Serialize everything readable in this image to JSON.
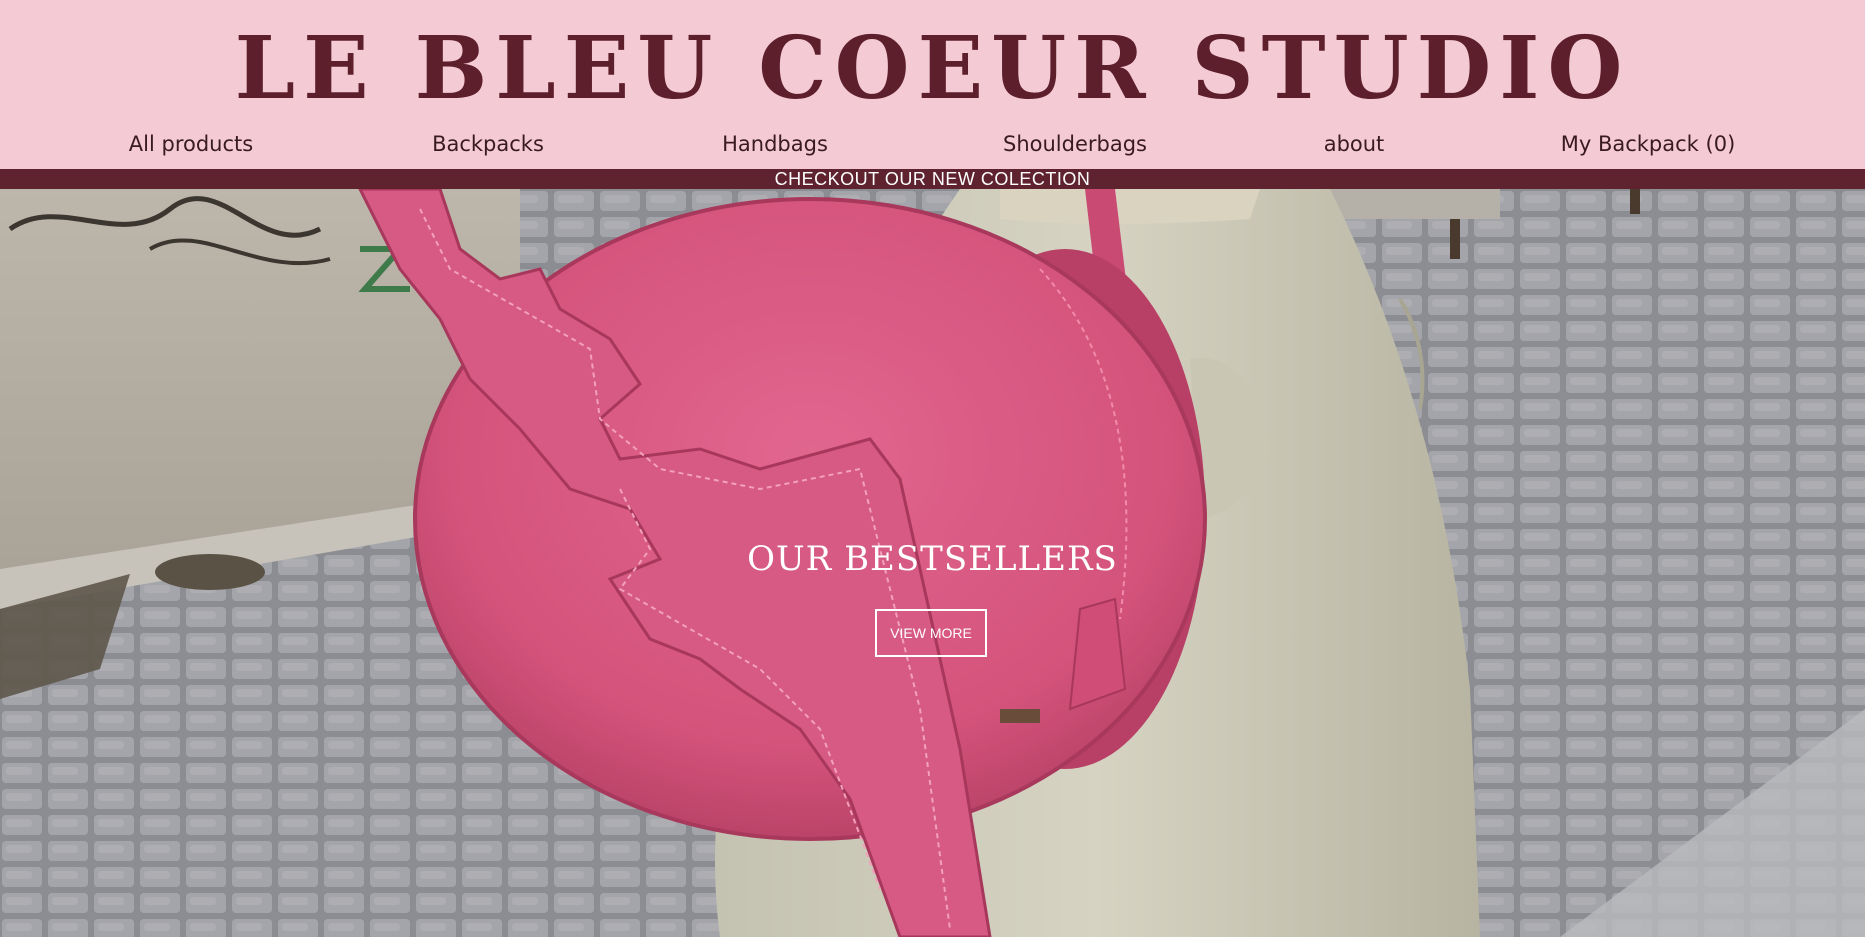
{
  "brand": {
    "name": "LE BLEU COEUR STUDIO"
  },
  "nav": {
    "items": [
      {
        "label": "All products"
      },
      {
        "label": "Backpacks"
      },
      {
        "label": "Handbags"
      },
      {
        "label": "Shoulderbags"
      },
      {
        "label": "about"
      },
      {
        "label": "My Backpack (0)"
      }
    ]
  },
  "announcement": {
    "text": "CHECKOUT OUR NEW COLECTION"
  },
  "hero": {
    "title": "OUR BESTSELLERS",
    "cta_label": "VIEW MORE",
    "image": "pink-bat-wing-shoulder-bag-photo"
  },
  "colors": {
    "header_bg": "#f4cbd5",
    "brand": "#5e1f2c",
    "announcement_bg": "#5e232f",
    "bag_pink": "#d8557f"
  }
}
